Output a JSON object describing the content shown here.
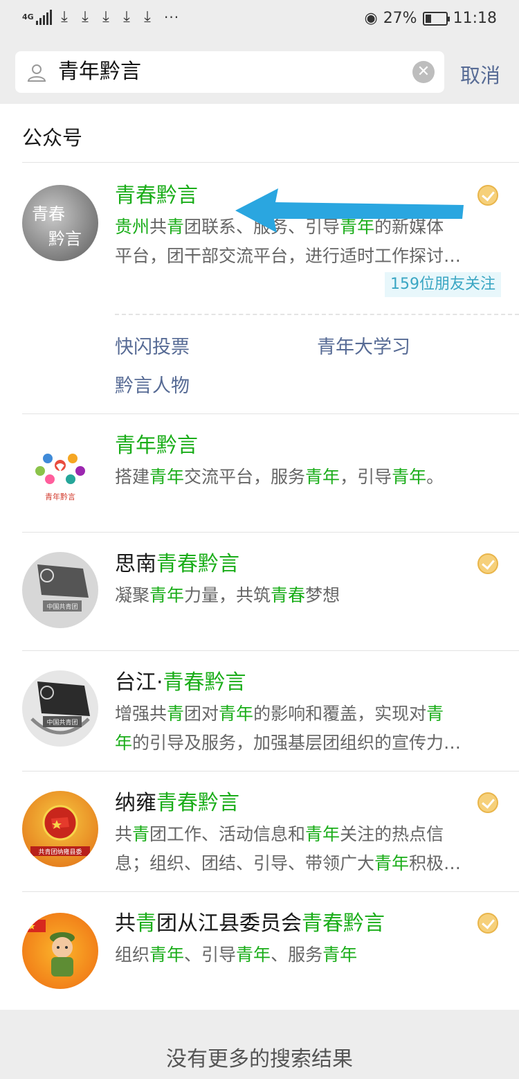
{
  "status_bar": {
    "network": "4G",
    "battery_percent": "27%",
    "time": "11:18",
    "icons": [
      "signal-icon",
      "download-icon",
      "download-icon",
      "download-icon",
      "download-icon",
      "download-icon",
      "more-icon",
      "eye-icon",
      "battery-icon"
    ]
  },
  "search": {
    "query": "青年黔言",
    "cancel_label": "取消"
  },
  "section": {
    "title": "公众号"
  },
  "accent_color": "#1aad19",
  "link_color": "#576b95",
  "results": [
    {
      "name_parts": [
        "青春黔言"
      ],
      "verified": true,
      "desc_line1_parts": [
        "贵州",
        "共",
        "青",
        "团联系、服务、引导",
        "青年",
        "的新媒体"
      ],
      "desc_line2": "平台，团干部交流平台，进行适时工作探讨…",
      "friends_tag": "159位朋友关注",
      "menu": [
        "快闪投票",
        "青年大学习",
        "黔言人物"
      ]
    },
    {
      "name_parts": [
        "青年黔言"
      ],
      "verified": false,
      "desc_parts": [
        "搭建",
        "青年",
        "交流平台，服务",
        "青年",
        "，引导",
        "青年",
        "。"
      ]
    },
    {
      "name_parts": [
        "思南",
        "青春黔言"
      ],
      "verified": true,
      "desc_parts": [
        "凝聚",
        "青年",
        "力量，共筑",
        "青春",
        "梦想"
      ]
    },
    {
      "name_parts": [
        "台江·",
        "青春黔言"
      ],
      "verified": false,
      "desc_line1_parts": [
        "增强共",
        "青",
        "团对",
        "青年",
        "的影响和覆盖，实现对",
        "青"
      ],
      "desc_line2_parts": [
        "年",
        "的引导及服务，加强基层团组织的宣传力…"
      ]
    },
    {
      "name_parts": [
        "纳雍",
        "青春黔言"
      ],
      "verified": true,
      "desc_line1_parts": [
        "共",
        "青",
        "团工作、活动信息和",
        "青年",
        "关注的热点信"
      ],
      "desc_line2_parts": [
        "息；组织、团结、引导、带领广大",
        "青年",
        "积极…"
      ]
    },
    {
      "name_parts": [
        "共",
        "青",
        "团从江县委员会",
        "青春黔言"
      ],
      "verified": true,
      "desc_parts": [
        "组织",
        "青年",
        "、引导",
        "青年",
        "、服务",
        "青年"
      ]
    }
  ],
  "avatars": {
    "a1_text": [
      "青春",
      "黔言"
    ],
    "a2_text": "青年黔言",
    "a3_text": "中国共青团",
    "a4_text": "中国共青团",
    "a5_text": "共青团纳雍县委"
  },
  "footer": {
    "text": "没有更多的搜索结果"
  }
}
